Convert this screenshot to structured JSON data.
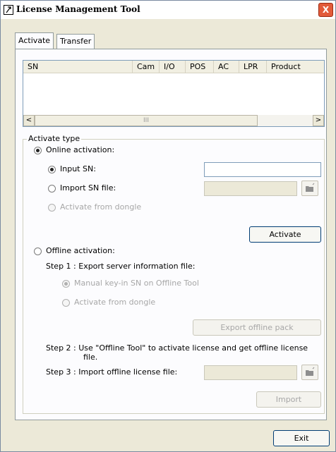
{
  "window": {
    "title": "License Management Tool",
    "close_glyph": "X"
  },
  "tabs": [
    {
      "label": "Activate"
    },
    {
      "label": "Transfer"
    }
  ],
  "list": {
    "columns": [
      "SN",
      "Cam",
      "I/O",
      "POS",
      "AC",
      "LPR",
      "Product"
    ],
    "rows": []
  },
  "scrollbar": {
    "left_glyph": "<",
    "right_glyph": ">",
    "thumb_glyph": "III"
  },
  "activate_type": {
    "legend": "Activate type",
    "online": {
      "label": "Online activation:",
      "selected": true,
      "input_sn": {
        "label": "Input SN:",
        "selected": true,
        "value": ""
      },
      "import_sn_file": {
        "label": "Import SN file:",
        "selected": false,
        "value": ""
      },
      "from_dongle": {
        "label": "Activate from dongle",
        "enabled": false
      },
      "activate_button": "Activate"
    },
    "offline": {
      "label": "Offline activation:",
      "selected": false,
      "step1": "Step 1 : Export server information file:",
      "manual_keyin": "Manual key-in SN on Offline Tool",
      "from_dongle": "Activate from dongle",
      "export_button": "Export offline pack",
      "step2_line1": "Step 2 : Use \"Offline Tool\" to activate license and get offline license",
      "step2_line2": "file.",
      "step3": "Step 3 : Import offline license file:",
      "import_value": "",
      "import_button": "Import"
    }
  },
  "footer": {
    "exit_button": "Exit"
  },
  "colors": {
    "close": "#e25a3a",
    "border_focus": "#003c74",
    "input_border": "#7f9db9",
    "disabled_text": "#a7a7a7"
  },
  "icons": {
    "title": "license-tool-icon",
    "folder": "folder-open-icon"
  }
}
